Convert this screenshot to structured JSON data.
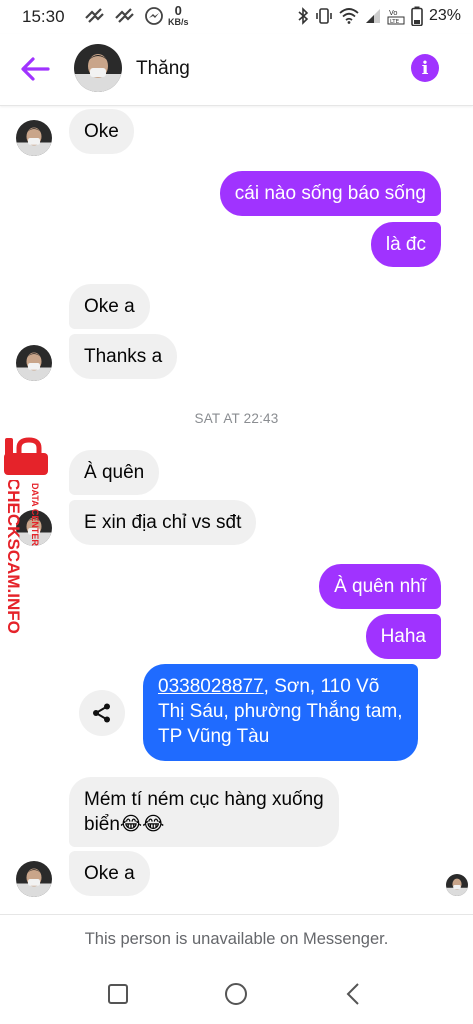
{
  "status_bar": {
    "time": "15:30",
    "net_speed_value": "0",
    "net_speed_unit": "KB/s",
    "battery_text": "23%"
  },
  "header": {
    "contact_name": "Thăng",
    "accent_color": "#a033ff"
  },
  "messages": [
    {
      "side": "in",
      "text": "Oke"
    },
    {
      "side": "out",
      "text": "cái nào sống báo sống"
    },
    {
      "side": "out",
      "text": "là đc"
    },
    {
      "side": "in",
      "text": "Oke a"
    },
    {
      "side": "in",
      "text": "Thanks a"
    },
    {
      "side": "in",
      "text": "À quên"
    },
    {
      "side": "in",
      "text": "E xin địa chỉ vs sđt"
    },
    {
      "side": "out",
      "text": "À quên nhĩ"
    },
    {
      "side": "out",
      "text": "Haha"
    },
    {
      "side": "out",
      "phone": "0338028877",
      "text_line1_rest": ", Sơn, 110 Võ",
      "text_line2": "Thị Sáu, phường Thắng tam,",
      "text_line3": "TP Vũng Tàu"
    },
    {
      "side": "in",
      "text_line1": "Mém tí ném cục hàng xuống",
      "text_line2": "biển😂😂"
    },
    {
      "side": "in",
      "text": "Oke a"
    }
  ],
  "timestamp": "SAT AT 22:43",
  "footer_notice": "This person is unavailable on Messenger.",
  "watermark": {
    "main": "CHECKSCAM.INFO",
    "sub": "DATA CENTER",
    "color": "#e5232a"
  },
  "colors": {
    "outgoing_bubble": "#a033ff",
    "highlight_bubble": "#1f6bff",
    "incoming_bubble": "#f0f0f0"
  }
}
